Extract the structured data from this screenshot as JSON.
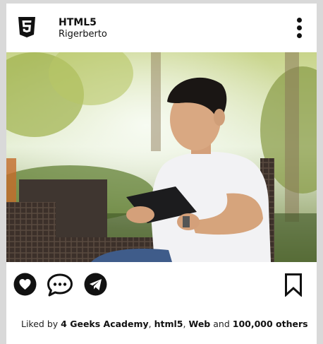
{
  "post": {
    "account_name": "HTML5",
    "username": "Rigerberto",
    "logo_icon": "html5-logo",
    "menu_icon": "vertical-ellipsis-icon"
  },
  "photo": {
    "subject": "man in white t-shirt using a tablet in a wicker chair outdoors"
  },
  "actions": {
    "like_icon": "heart-icon",
    "comment_icon": "speech-bubble-icon",
    "share_icon": "paper-plane-icon",
    "save_icon": "bookmark-icon"
  },
  "likes": {
    "prefix": "Liked by",
    "name_1": "4 Geeks Academy",
    "sep_1": ",",
    "name_2": "html5",
    "sep_2": ",",
    "name_3": "Web",
    "conj": "and",
    "others": "100,000 others"
  },
  "colors": {
    "background": "#d9d9d9",
    "card": "#ffffff",
    "text": "#111111"
  }
}
